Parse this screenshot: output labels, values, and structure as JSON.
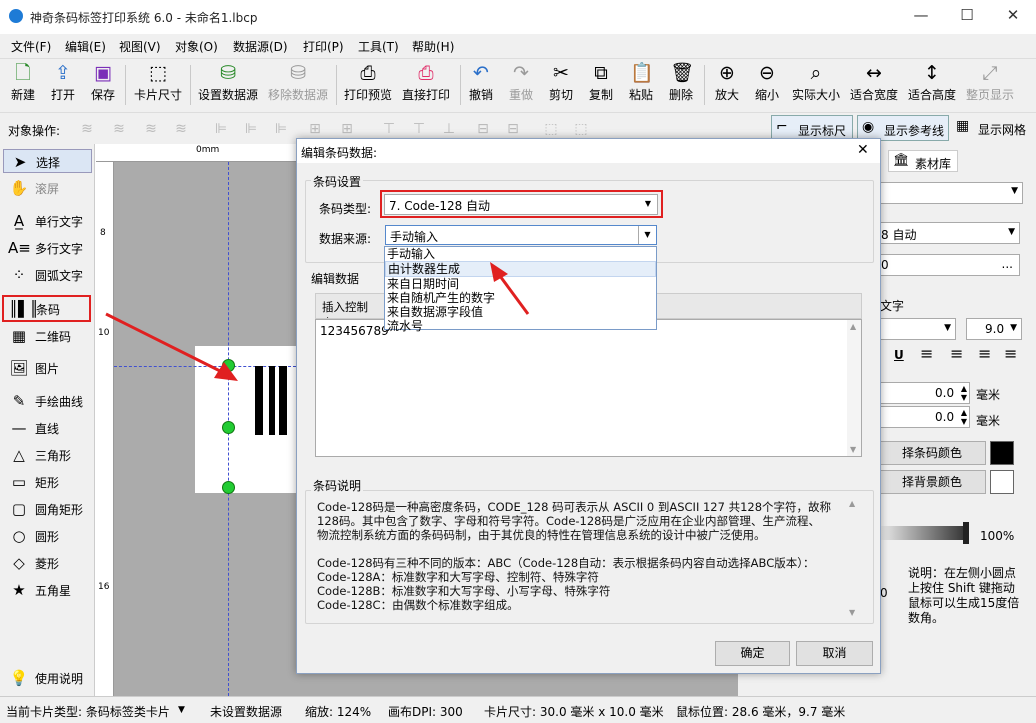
{
  "window": {
    "title": "神奇条码标签打印系统 6.0 - 未命名1.lbcp",
    "minimize": "—",
    "maximize": "☐",
    "close": "✕"
  },
  "menu": [
    "文件(F)",
    "编辑(E)",
    "视图(V)",
    "对象(O)",
    "数据源(D)",
    "打印(P)",
    "工具(T)",
    "帮助(H)"
  ],
  "toolbar": {
    "new": "新建",
    "open": "打开",
    "save": "保存",
    "card_size": "卡片尺寸",
    "set_datasource": "设置数据源",
    "remove_datasource": "移除数据源",
    "print_preview": "打印预览",
    "direct_print": "直接打印",
    "undo": "撤销",
    "redo": "重做",
    "cut": "剪切",
    "copy": "复制",
    "paste": "粘贴",
    "delete": "删除",
    "zoom_in": "放大",
    "zoom_out": "缩小",
    "actual_size": "实际大小",
    "fit_width": "适合宽度",
    "fit_height": "适合高度",
    "full_page": "整页显示"
  },
  "objbar": {
    "label": "对象操作:",
    "show_ruler": "显示标尺",
    "show_guides": "显示参考线",
    "show_grid": "显示网格"
  },
  "tools": [
    "选择",
    "滚屏",
    "单行文字",
    "多行文字",
    "圆弧文字",
    "条码",
    "二维码",
    "图片",
    "手绘曲线",
    "直线",
    "三角形",
    "矩形",
    "圆角矩形",
    "圆形",
    "菱形",
    "五角星",
    "使用说明"
  ],
  "ruler": {
    "zero": "0mm",
    "v8": "8",
    "v10": "10",
    "v16": "16"
  },
  "dialog": {
    "title": "编辑条码数据:",
    "barcode_settings": "条码设置",
    "barcode_type_label": "条码类型:",
    "barcode_type_value": "7.  Code-128 自动",
    "datasource_label": "数据来源:",
    "datasource_value": "手动输入",
    "datasource_options": [
      "手动输入",
      "由计数器生成",
      "来自日期时间",
      "来自随机产生的数字",
      "来自数据源字段值",
      "流水号"
    ],
    "edit_data": "编辑数据",
    "insert_control_char": "插入控制字",
    "data_value": "123456789",
    "desc_title": "条码说明",
    "desc_lines": [
      "Code-128码是一种高密度条码，CODE_128 码可表示从 ASCII 0 到ASCII 127 共128个字符，故称",
      "128码。其中包含了数字、字母和符号字符。Code-128码是广泛应用在企业内部管理、生产流程、",
      "物流控制系统方面的条码码制，由于其优良的特性在管理信息系统的设计中被广泛使用。",
      "",
      "Code-128码有三种不同的版本：ABC（Code-128自动：表示根据条码内容自动选择ABC版本）：",
      "Code-128A：标准数字和大写字母、控制符、特殊字符",
      "Code-128B：标准数字和大写字母、小写字母、特殊字符",
      "Code-128C：由偶数个标准数字组成。"
    ],
    "ok": "确定",
    "cancel": "取消"
  },
  "rightpanel": {
    "material_tab": "素材库",
    "code_auto": "8 自动",
    "zero_tail": "0",
    "ellipsis": "...",
    "text_label": "文字",
    "font_size": "9.0",
    "underline": "U",
    "offset1": "0.0",
    "offset2": "0.0",
    "unit": "毫米",
    "barcode_color": "择条码颜色",
    "bg_color": "择背景颜色",
    "opacity": "100%",
    "note": [
      "说明：在左侧小圆点",
      "上按住 Shift 键拖动",
      "鼠标可以生成15度倍",
      "数角。"
    ],
    "zero2": "0"
  },
  "status": {
    "card_type": "当前卡片类型:  条码标签类卡片",
    "datasource": "未设置数据源",
    "zoom": "缩放:  124%",
    "dpi": "画布DPI:  300",
    "card_size": "卡片尺寸:  30.0 毫米 x 10.0 毫米",
    "mouse_pos": "鼠标位置:  28.6 毫米，9.7 毫米"
  },
  "colors": {
    "accent": "#1e7bd6",
    "highlight_red": "#e02020",
    "canvas_bg": "#ababab"
  }
}
